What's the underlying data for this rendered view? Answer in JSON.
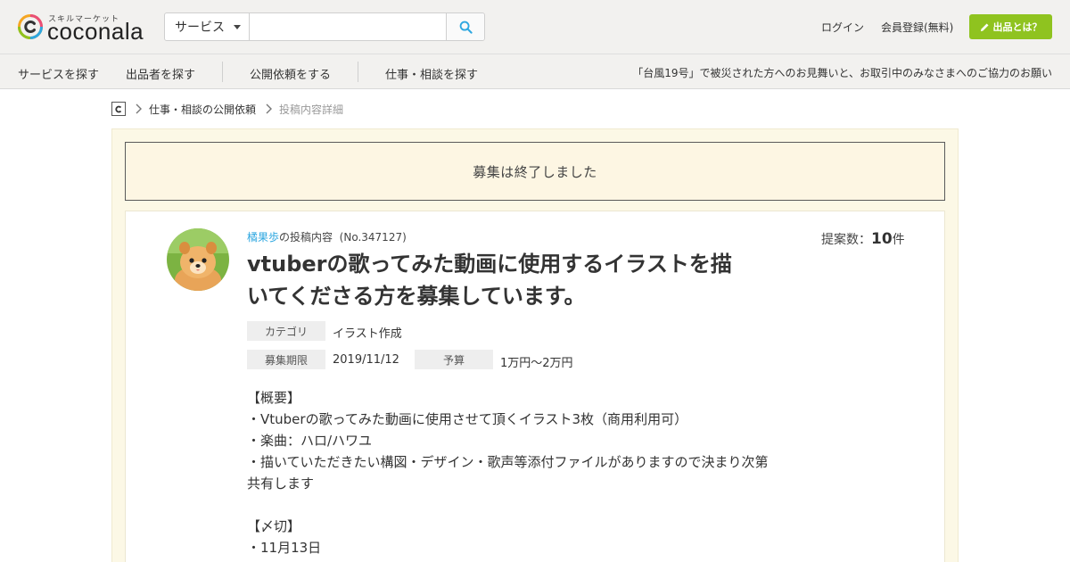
{
  "header": {
    "logo_tagline": "スキルマーケット",
    "logo_word": "coconala",
    "search": {
      "category": "サービス",
      "placeholder": ""
    },
    "login": "ログイン",
    "register": "会員登録(無料)",
    "sell_button": "出品とは？"
  },
  "subnav": {
    "items": [
      "サービスを探す",
      "出品者を探す",
      "公開依頼をする",
      "仕事・相談を探す"
    ],
    "notice": "「台風19号」で被災された方へのお見舞いと、お取引中のみなさまへのご協力のお願い"
  },
  "breadcrumb": {
    "parent": "仕事・相談の公開依頼",
    "current": "投稿内容詳細"
  },
  "status": {
    "closed_message": "募集は終了しました"
  },
  "post": {
    "author": "橘果歩",
    "author_suffix": "の投稿内容",
    "number": "(No.347127)",
    "title": "vtuberの歌ってみた動画に使用するイラストを描いてくださる方を募集しています。",
    "proposals_label": "提案数：",
    "proposals_count": "10",
    "proposals_unit": "件",
    "category_label": "カテゴリ",
    "category": "イラスト作成",
    "deadline_label": "募集期限",
    "deadline": "2019/11/12",
    "budget_label": "予算",
    "budget": "1万円〜2万円",
    "description": {
      "overview_heading": "【概要】",
      "line1": "・Vtuberの歌ってみた動画に使用させて頂くイラスト3枚（商用利用可）",
      "line2": "・楽曲：ハロ/ハワユ",
      "line3a": "・描いていただきたい構図・デザイン・歌声等添付ファイルがありますので決まり次第",
      "line3b": "共有します",
      "deadline_heading": "【〆切】",
      "line4": "・11月13日"
    }
  },
  "colors": {
    "accent_green": "#8fc31f",
    "link_blue": "#2ea7e0",
    "panel_cream": "#fcf8e6"
  }
}
